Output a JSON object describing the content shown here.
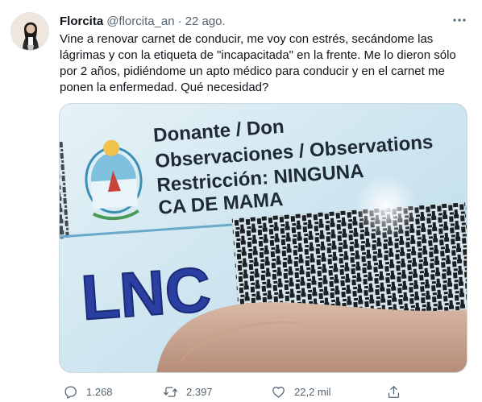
{
  "tweet": {
    "display_name": "Florcita",
    "handle": "@florcita_an",
    "separator": "·",
    "time": "22 ago.",
    "text": "Vine a renovar carnet de conducir, me voy con estrés, secándome las lágrimas y con la etiqueta de \"incapacitada\" en la frente. Me lo dieron sólo por 2 años, pidiéndome un apto médico para conducir y en el carnet me ponen la enfermedad. Qué necesidad?",
    "icons": {
      "more": "more-icon",
      "reply": "reply-icon",
      "retweet": "retweet-icon",
      "like": "like-icon",
      "share": "share-icon"
    },
    "actions": {
      "reply_count": "1.268",
      "retweet_count": "2.397",
      "like_count": "22,2 mil"
    },
    "media": {
      "line1": "Donante / Don",
      "line2": "Observaciones / Observations",
      "line3": "Restricción: NINGUNA",
      "line4": "CA DE MAMA",
      "logo": "LNC"
    }
  },
  "colors": {
    "text_primary": "#0f1419",
    "text_secondary": "#536471",
    "card_blue": "#cfe6f0",
    "logo_blue": "#2a3fa0"
  }
}
